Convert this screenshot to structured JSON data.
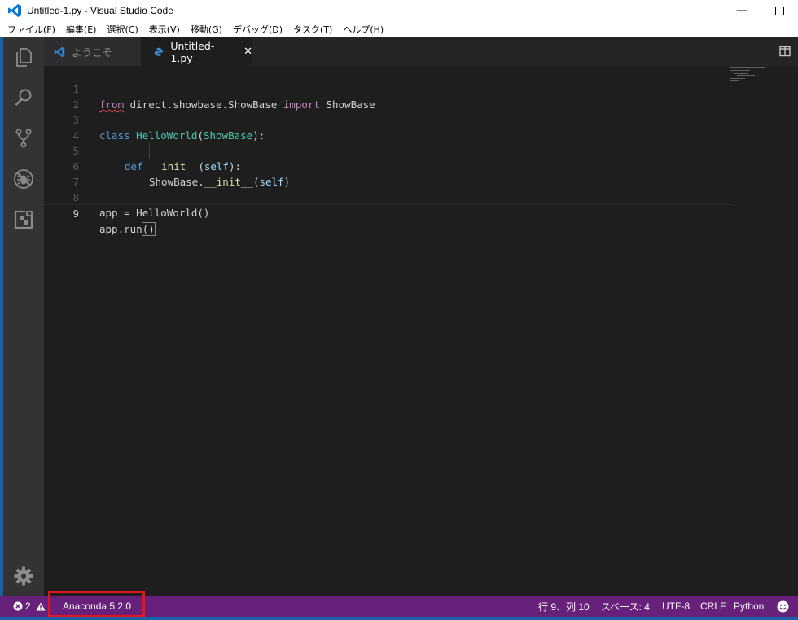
{
  "window": {
    "title": "Untitled-1.py - Visual Studio Code",
    "minimize_symbol": "—",
    "maximize_symbol": "☐"
  },
  "menu": [
    "ファイル(F)",
    "編集(E)",
    "選択(C)",
    "表示(V)",
    "移動(G)",
    "デバッグ(D)",
    "タスク(T)",
    "ヘルプ(H)"
  ],
  "tabs": [
    {
      "label": "ようこそ",
      "active": false
    },
    {
      "label": "Untitled-1.py",
      "active": true,
      "close_symbol": "✕"
    }
  ],
  "editor": {
    "line_numbers": [
      "1",
      "2",
      "3",
      "4",
      "5",
      "6",
      "7",
      "8",
      "9"
    ],
    "current_line": "9",
    "lines": {
      "l1": {
        "from": "from",
        "mod": " direct.showbase.ShowBase ",
        "import": "import",
        "name": " ShowBase"
      },
      "l3": {
        "class": "class",
        "sp": " ",
        "name": "HelloWorld",
        "open": "(",
        "base": "ShowBase",
        "close": "):"
      },
      "l5": {
        "def": "def",
        "sp": " ",
        "name": "__init__",
        "open": "(",
        "self": "self",
        "close": "):"
      },
      "l6": {
        "obj": "ShowBase.",
        "name": "__init__",
        "open": "(",
        "self": "self",
        "close": ")"
      },
      "l8": {
        "text": "app = HelloWorld()"
      },
      "l9": {
        "text": "app.run",
        "parens": "()"
      }
    }
  },
  "statusbar": {
    "errors": "2",
    "warnings": "",
    "interpreter": "Anaconda 5.2.0",
    "position": "行 9、列 10",
    "spaces": "スペース: 4",
    "encoding": "UTF-8",
    "eol": "CRLF",
    "language": "Python"
  },
  "colors": {
    "statusbar": "#68217a",
    "highlight_box": "#e8141c",
    "activity_bar": "#333333",
    "editor_bg": "#1e1e1e"
  },
  "icons": {
    "activity": [
      "explorer-icon",
      "search-icon",
      "source-control-icon",
      "debug-icon",
      "extensions-icon",
      "settings-gear-icon"
    ]
  }
}
